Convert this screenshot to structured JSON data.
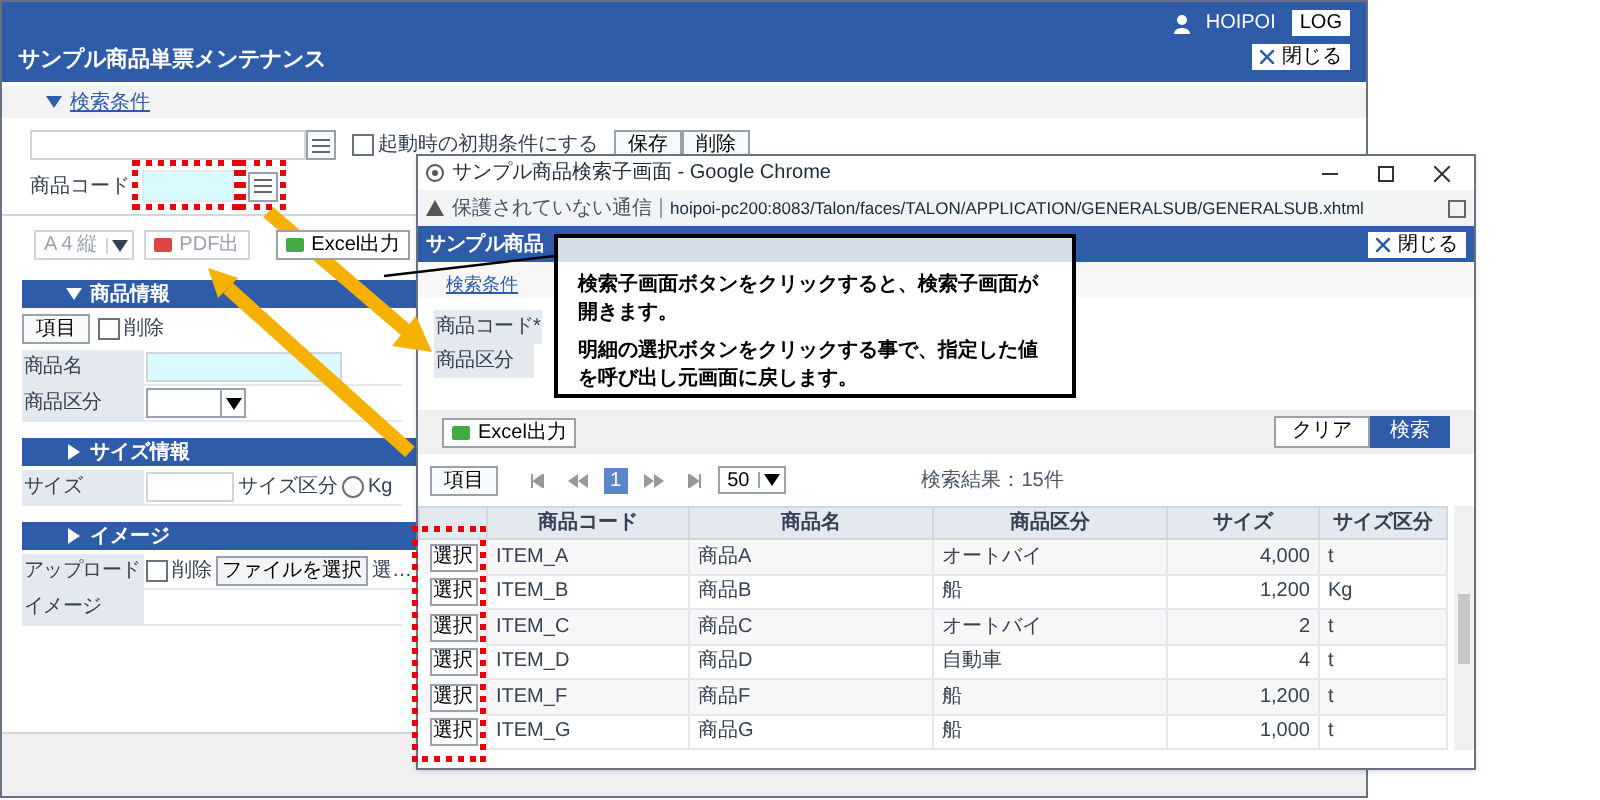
{
  "app": {
    "title": "サンプル商品単票メンテナンス",
    "user": "HOIPOI",
    "logout_button": "LOG",
    "close_button": "閉じる"
  },
  "search_section": {
    "label": "検索条件",
    "expanded": true
  },
  "search_form": {
    "initial_checkbox": {
      "label": "起動時の初期条件にする",
      "checked": false
    },
    "save_button": "保存",
    "delete_button": "削除",
    "code_label": "商品コード"
  },
  "toolbar": {
    "paper_select": "A４縦",
    "pdf_button": "PDF出",
    "excel_button": "Excel出力"
  },
  "sections": [
    {
      "title": "商品情報",
      "expanded": true,
      "items_button": "項目",
      "delete_checkbox": {
        "label": "削除",
        "checked": false
      },
      "rows": [
        {
          "kind": "text",
          "label": "商品名",
          "highlight": true
        },
        {
          "kind": "select",
          "label": "商品区分"
        }
      ]
    },
    {
      "title": "サイズ情報",
      "expanded": false,
      "rows": [
        {
          "kind": "text_radio",
          "label": "サイズ",
          "label2": "サイズ区分",
          "radio": {
            "label": "Kg",
            "selected": false
          }
        }
      ]
    },
    {
      "title": "イメージ",
      "expanded": false,
      "rows": [
        {
          "kind": "upload",
          "label": "アップロード",
          "checkbox": {
            "label": "削除",
            "checked": false
          },
          "button": "ファイルを選択",
          "status": "選…"
        },
        {
          "kind": "empty",
          "label": "イメージ"
        }
      ]
    }
  ],
  "popup": {
    "title": "サンプル商品検索子画面 - Google Chrome",
    "security": "保護されていない通信",
    "url": "hoipoi-pc200:8083/Talon/faces/TALON/APPLICATION/GENERALSUB/GENERALSUB.xhtml",
    "header": "サンプル商品",
    "close_button": "閉じる",
    "search_link": "検索条件",
    "field_labels": [
      "商品コード*",
      "商品区分"
    ],
    "excel_button": "Excel出力",
    "clear_button": "クリア",
    "search_button": "検索",
    "items_button": "項目",
    "pages": [
      {
        "label": "1",
        "selected": true
      }
    ],
    "page_size": "50",
    "result": "検索結果：15件",
    "columns": [
      "商品コード",
      "商品名",
      "商品区分",
      "サイズ",
      "サイズ区分"
    ],
    "rows": [
      {
        "select": "選択",
        "cells": [
          "ITEM_A",
          "商品A",
          "オートバイ",
          "4,000",
          "t"
        ]
      },
      {
        "select": "選択",
        "cells": [
          "ITEM_B",
          "商品B",
          "船",
          "1,200",
          "Kg"
        ]
      },
      {
        "select": "選択",
        "cells": [
          "ITEM_C",
          "商品C",
          "オートバイ",
          "2",
          "t"
        ]
      },
      {
        "select": "選択",
        "cells": [
          "ITEM_D",
          "商品D",
          "自動車",
          "4",
          "t"
        ]
      },
      {
        "select": "選択",
        "cells": [
          "ITEM_F",
          "商品F",
          "船",
          "1,200",
          "t"
        ]
      },
      {
        "select": "選択",
        "cells": [
          "ITEM_G",
          "商品G",
          "船",
          "1,000",
          "t"
        ]
      }
    ]
  },
  "callout": {
    "lines": [
      "検索子画面ボタンをクリックすると、検索子画面が開きます。",
      "明細の選択ボタンをクリックする事で、指定した値を呼び出し元画面に戻します。"
    ]
  }
}
